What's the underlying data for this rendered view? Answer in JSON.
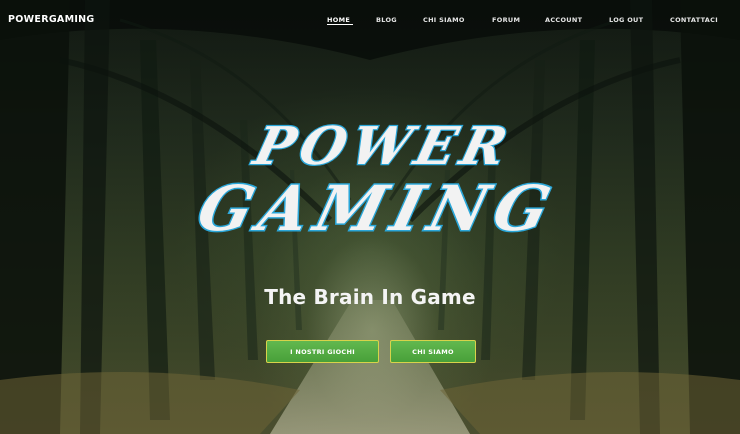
{
  "header": {
    "brand": "POWERGAMING",
    "nav": [
      {
        "label": "HOME",
        "active": true
      },
      {
        "label": "BLOG"
      },
      {
        "label": "CHI SIAMO"
      },
      {
        "label": "FORUM"
      },
      {
        "label": "ACCOUNT"
      },
      {
        "label": "LOG OUT"
      },
      {
        "label": "CONTATTACI"
      }
    ]
  },
  "hero": {
    "logo_line1": "POWER",
    "logo_line2": "GAMING",
    "tagline": "The Brain In Game",
    "buttons": {
      "games": "I NOSTRI GIOCHI",
      "about": "CHI SIAMO"
    }
  },
  "colors": {
    "accent_green": "#56ad45",
    "button_border": "#d8d34a",
    "logo_outline": "#2aa6d8",
    "text": "#ffffff"
  }
}
